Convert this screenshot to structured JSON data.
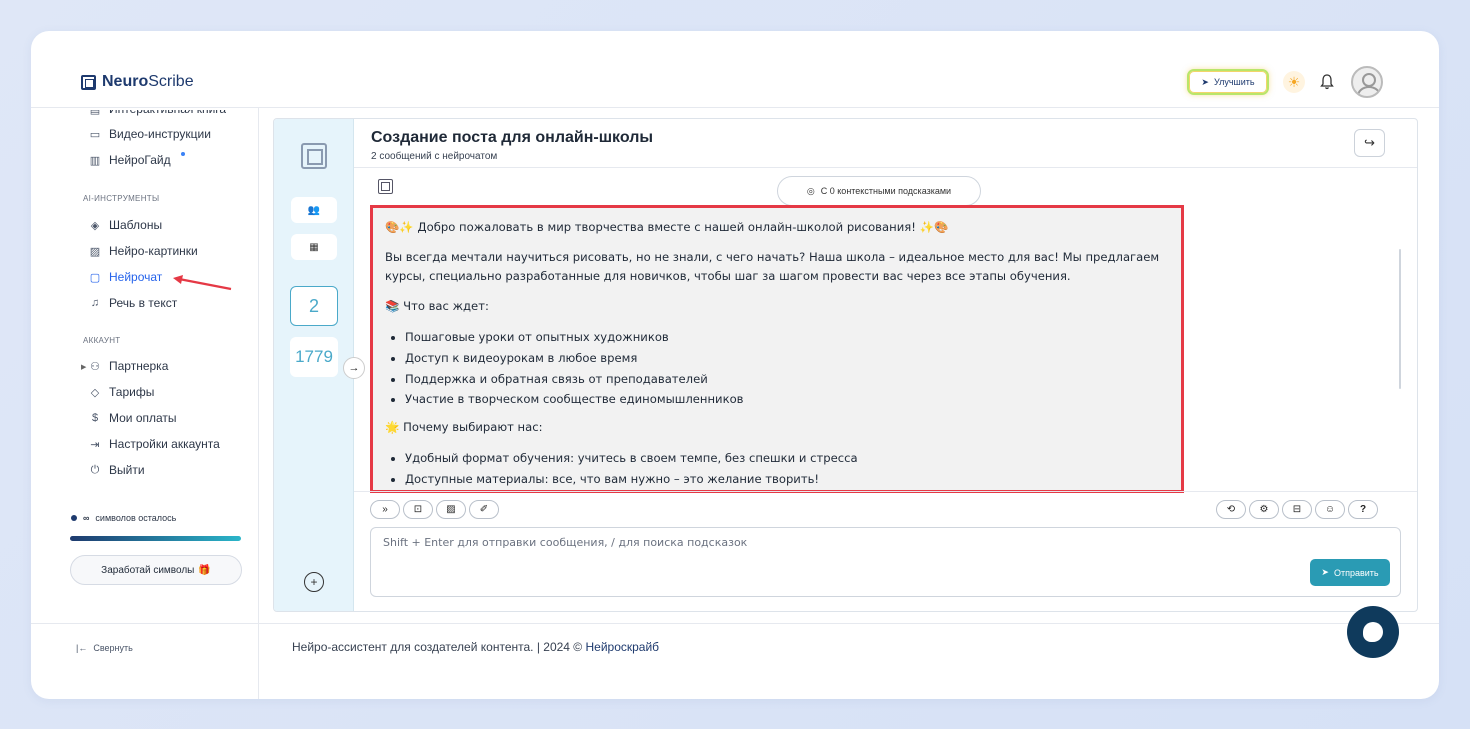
{
  "header": {
    "logo_bold": "Neuro",
    "logo_regular": "Scribe",
    "upgrade_label": "Улучшить"
  },
  "sidebar": {
    "top_items": [
      {
        "label": "Интерактивная книга",
        "icon": "book-icon"
      },
      {
        "label": "Видео-инструкции",
        "icon": "video-icon"
      },
      {
        "label": "НейроГайд",
        "icon": "guide-icon"
      }
    ],
    "section_ai": "AI-ИНСТРУМЕНТЫ",
    "ai_items": [
      {
        "label": "Шаблоны",
        "icon": "layers-icon"
      },
      {
        "label": "Нейро-картинки",
        "icon": "image-icon"
      },
      {
        "label": "Нейрочат",
        "icon": "chat-icon"
      },
      {
        "label": "Речь в текст",
        "icon": "headphones-icon"
      }
    ],
    "section_account": "АККАУНТ",
    "account_items": [
      {
        "label": "Партнерка",
        "icon": "users-icon"
      },
      {
        "label": "Тарифы",
        "icon": "tag-icon"
      },
      {
        "label": "Мои оплаты",
        "icon": "dollar-icon"
      },
      {
        "label": "Настройки аккаунта",
        "icon": "settings-icon"
      },
      {
        "label": "Выйти",
        "icon": "power-icon"
      }
    ],
    "symbols_value": "∞",
    "symbols_label": "символов осталось",
    "earn_label": "Заработай символы",
    "collapse_label": "Свернуть"
  },
  "strip": {
    "message_count": "2",
    "char_count": "1779"
  },
  "chat": {
    "title": "Создание поста для онлайн-школы",
    "subtitle": "2 сообщений с нейрочатом",
    "hints_label": "С 0 контекстными подсказками",
    "message": {
      "greeting": "🎨✨ Добро пожаловать в мир творчества вместе с нашей онлайн-школой рисования! ✨🎨",
      "intro": "Вы всегда мечтали научиться рисовать, но не знали, с чего начать? Наша школа – идеальное место для вас! Мы предлагаем курсы, специально разработанные для новичков, чтобы шаг за шагом провести вас через все этапы обучения.",
      "what_heading": "📚 Что вас ждет:",
      "what_items": [
        "Пошаговые уроки от опытных художников",
        "Доступ к видеоурокам в любое время",
        "Поддержка и обратная связь от преподавателей",
        "Участие в творческом сообществе единомышленников"
      ],
      "why_heading": "🌟 Почему выбирают нас:",
      "why_items": [
        "Удобный формат обучения: учитесь в своем темпе, без спешки и стресса",
        "Доступные материалы: все, что вам нужно – это желание творить!"
      ]
    },
    "input_placeholder": "Shift + Enter для отправки сообщения, / для поиска подсказок",
    "send_label": "Отправить"
  },
  "footer": {
    "text": "Нейро-ассистент для создателей контента.  | 2024 © ",
    "link": "Нейроскрайб"
  },
  "colors": {
    "accent": "#2a9bb4",
    "brand": "#1e3a6e",
    "highlight_border": "#e53945"
  }
}
